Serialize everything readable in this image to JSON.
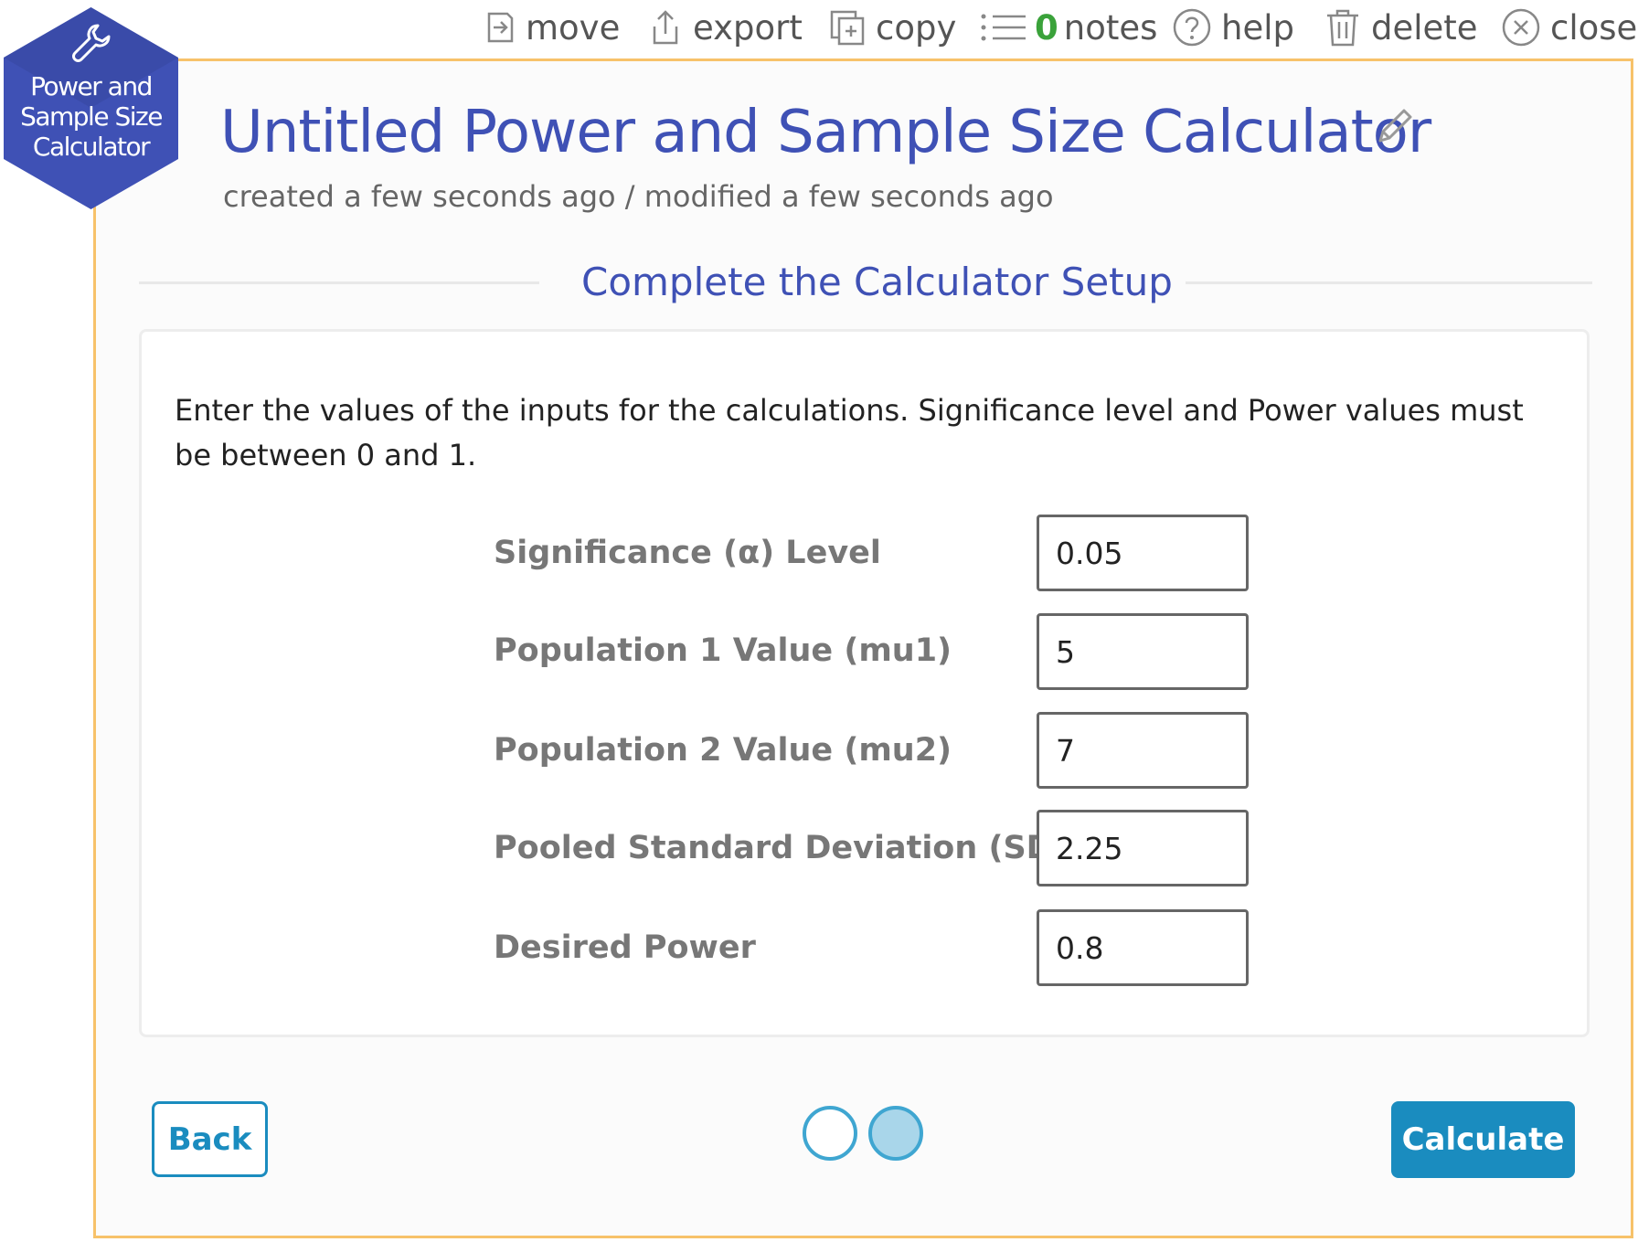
{
  "toolbar": {
    "move": "move",
    "export": "export",
    "copy": "copy",
    "notes_count": "0",
    "notes": "notes",
    "help": "help",
    "delete": "delete",
    "close": "close"
  },
  "badge": {
    "text": "Power and\nSample Size\nCalculator",
    "icon": "wrench-icon"
  },
  "header": {
    "title": "Untitled Power and Sample Size Calculator",
    "subtitle": "created a few seconds ago / modified a few seconds ago"
  },
  "section": {
    "title": "Complete the Calculator Setup"
  },
  "instructions": "Enter the values of the inputs for the calculations. Significance level and Power values must be between 0 and 1.",
  "fields": [
    {
      "label": "Significance (α) Level",
      "value": "0.05"
    },
    {
      "label": "Population 1 Value (mu1)",
      "value": "5"
    },
    {
      "label": "Population 2 Value (mu2)",
      "value": "7"
    },
    {
      "label": "Pooled Standard Deviation (SD)",
      "value": "2.25"
    },
    {
      "label": "Desired Power",
      "value": "0.8"
    }
  ],
  "footer": {
    "back": "Back",
    "calculate": "Calculate",
    "steps_total": 2,
    "current_step": 2
  },
  "colors": {
    "brand": "#3f51b5",
    "accent": "#1a8cbf",
    "card_border": "#f7c26a",
    "notes_count": "#3aa23a"
  }
}
